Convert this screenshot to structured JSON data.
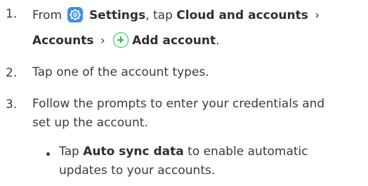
{
  "steps": [
    {
      "num": "1.",
      "line1": {
        "from": "From",
        "settings": "Settings",
        "tap": ", tap",
        "cloud": "Cloud and accounts",
        "sep1": "›"
      },
      "line2": {
        "accounts": "Accounts",
        "sep2": "›",
        "add": "Add account",
        "period": "."
      }
    },
    {
      "num": "2.",
      "text": "Tap one of the account types."
    },
    {
      "num": "3.",
      "text1": "Follow the prompts to enter your credentials and",
      "text2": "set up the account."
    }
  ],
  "bullet": {
    "tap": "Tap",
    "auto": "Auto sync data",
    "rest1": "to enable automatic",
    "rest2": "updates to your accounts."
  },
  "icons": {
    "settings": "settings-gear-icon",
    "add": "add-plus-circle-icon"
  },
  "colors": {
    "settings_icon_bg": "#3f8ee8",
    "add_icon": "#1db94d",
    "text": "#3a3a3a"
  }
}
